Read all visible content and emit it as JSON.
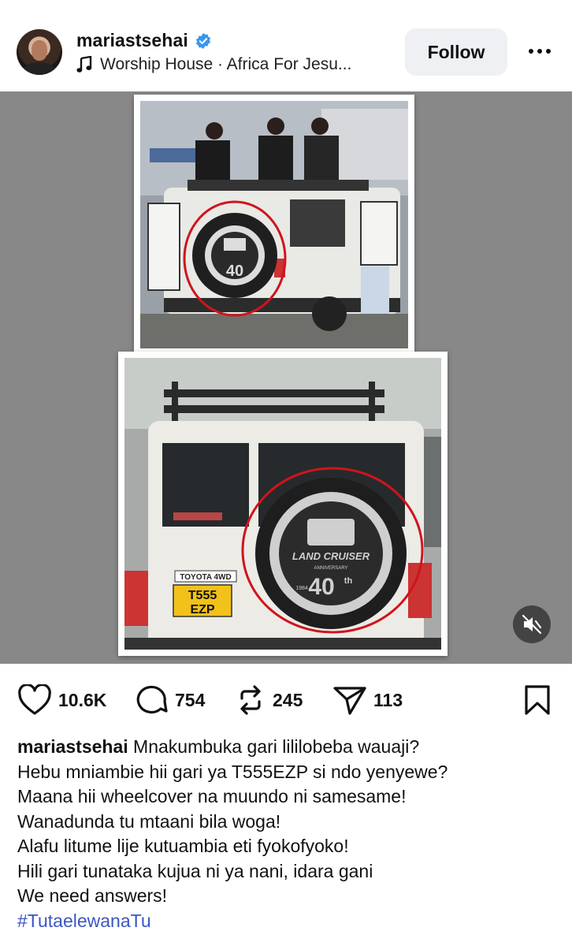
{
  "header": {
    "username": "mariastsehai",
    "verified": true,
    "music_label": "Worship House · Africa For Jesu...",
    "follow_label": "Follow",
    "more_icon": "more-horizontal-icon"
  },
  "media": {
    "photo_top_caption": "",
    "spare_tire_top_text": "40",
    "spare_tire_bottom_brand": "LAND CRUISER",
    "spare_tire_bottom_sub": "ANNIVERSARY",
    "spare_tire_bottom_number": "40",
    "spare_tire_bottom_suffix": "th",
    "spare_tire_bottom_year": "1984",
    "badge_text": "TOYOTA 4WD",
    "plate_line1": "T555",
    "plate_line2": "EZP",
    "mute_icon": "speaker-muted-icon"
  },
  "actions": {
    "likes": "10.6K",
    "comments": "754",
    "reposts": "245",
    "shares": "113"
  },
  "caption": {
    "username": "mariastsehai",
    "line1": "Mnakumbuka gari lililobeba wauaji?",
    "line2": "Hebu mniambie hii gari ya T555EZP si ndo yenyewe?",
    "line3": "Maana hii wheelcover na muundo ni samesame!",
    "line4": "Wanadunda tu mtaani bila woga!",
    "line5": "Alafu litume lije kutuambia eti fyokofyoko!",
    "line6": "Hili gari tunataka kujua ni ya nani, idara gani",
    "line7": "We need answers!",
    "hashtag": "#TutaelewanaTu"
  },
  "colors": {
    "verified_blue": "#3897f0",
    "hashtag_blue": "#3c56c4",
    "circle_red": "#d0141c",
    "plate_yellow": "#f2c21a"
  }
}
